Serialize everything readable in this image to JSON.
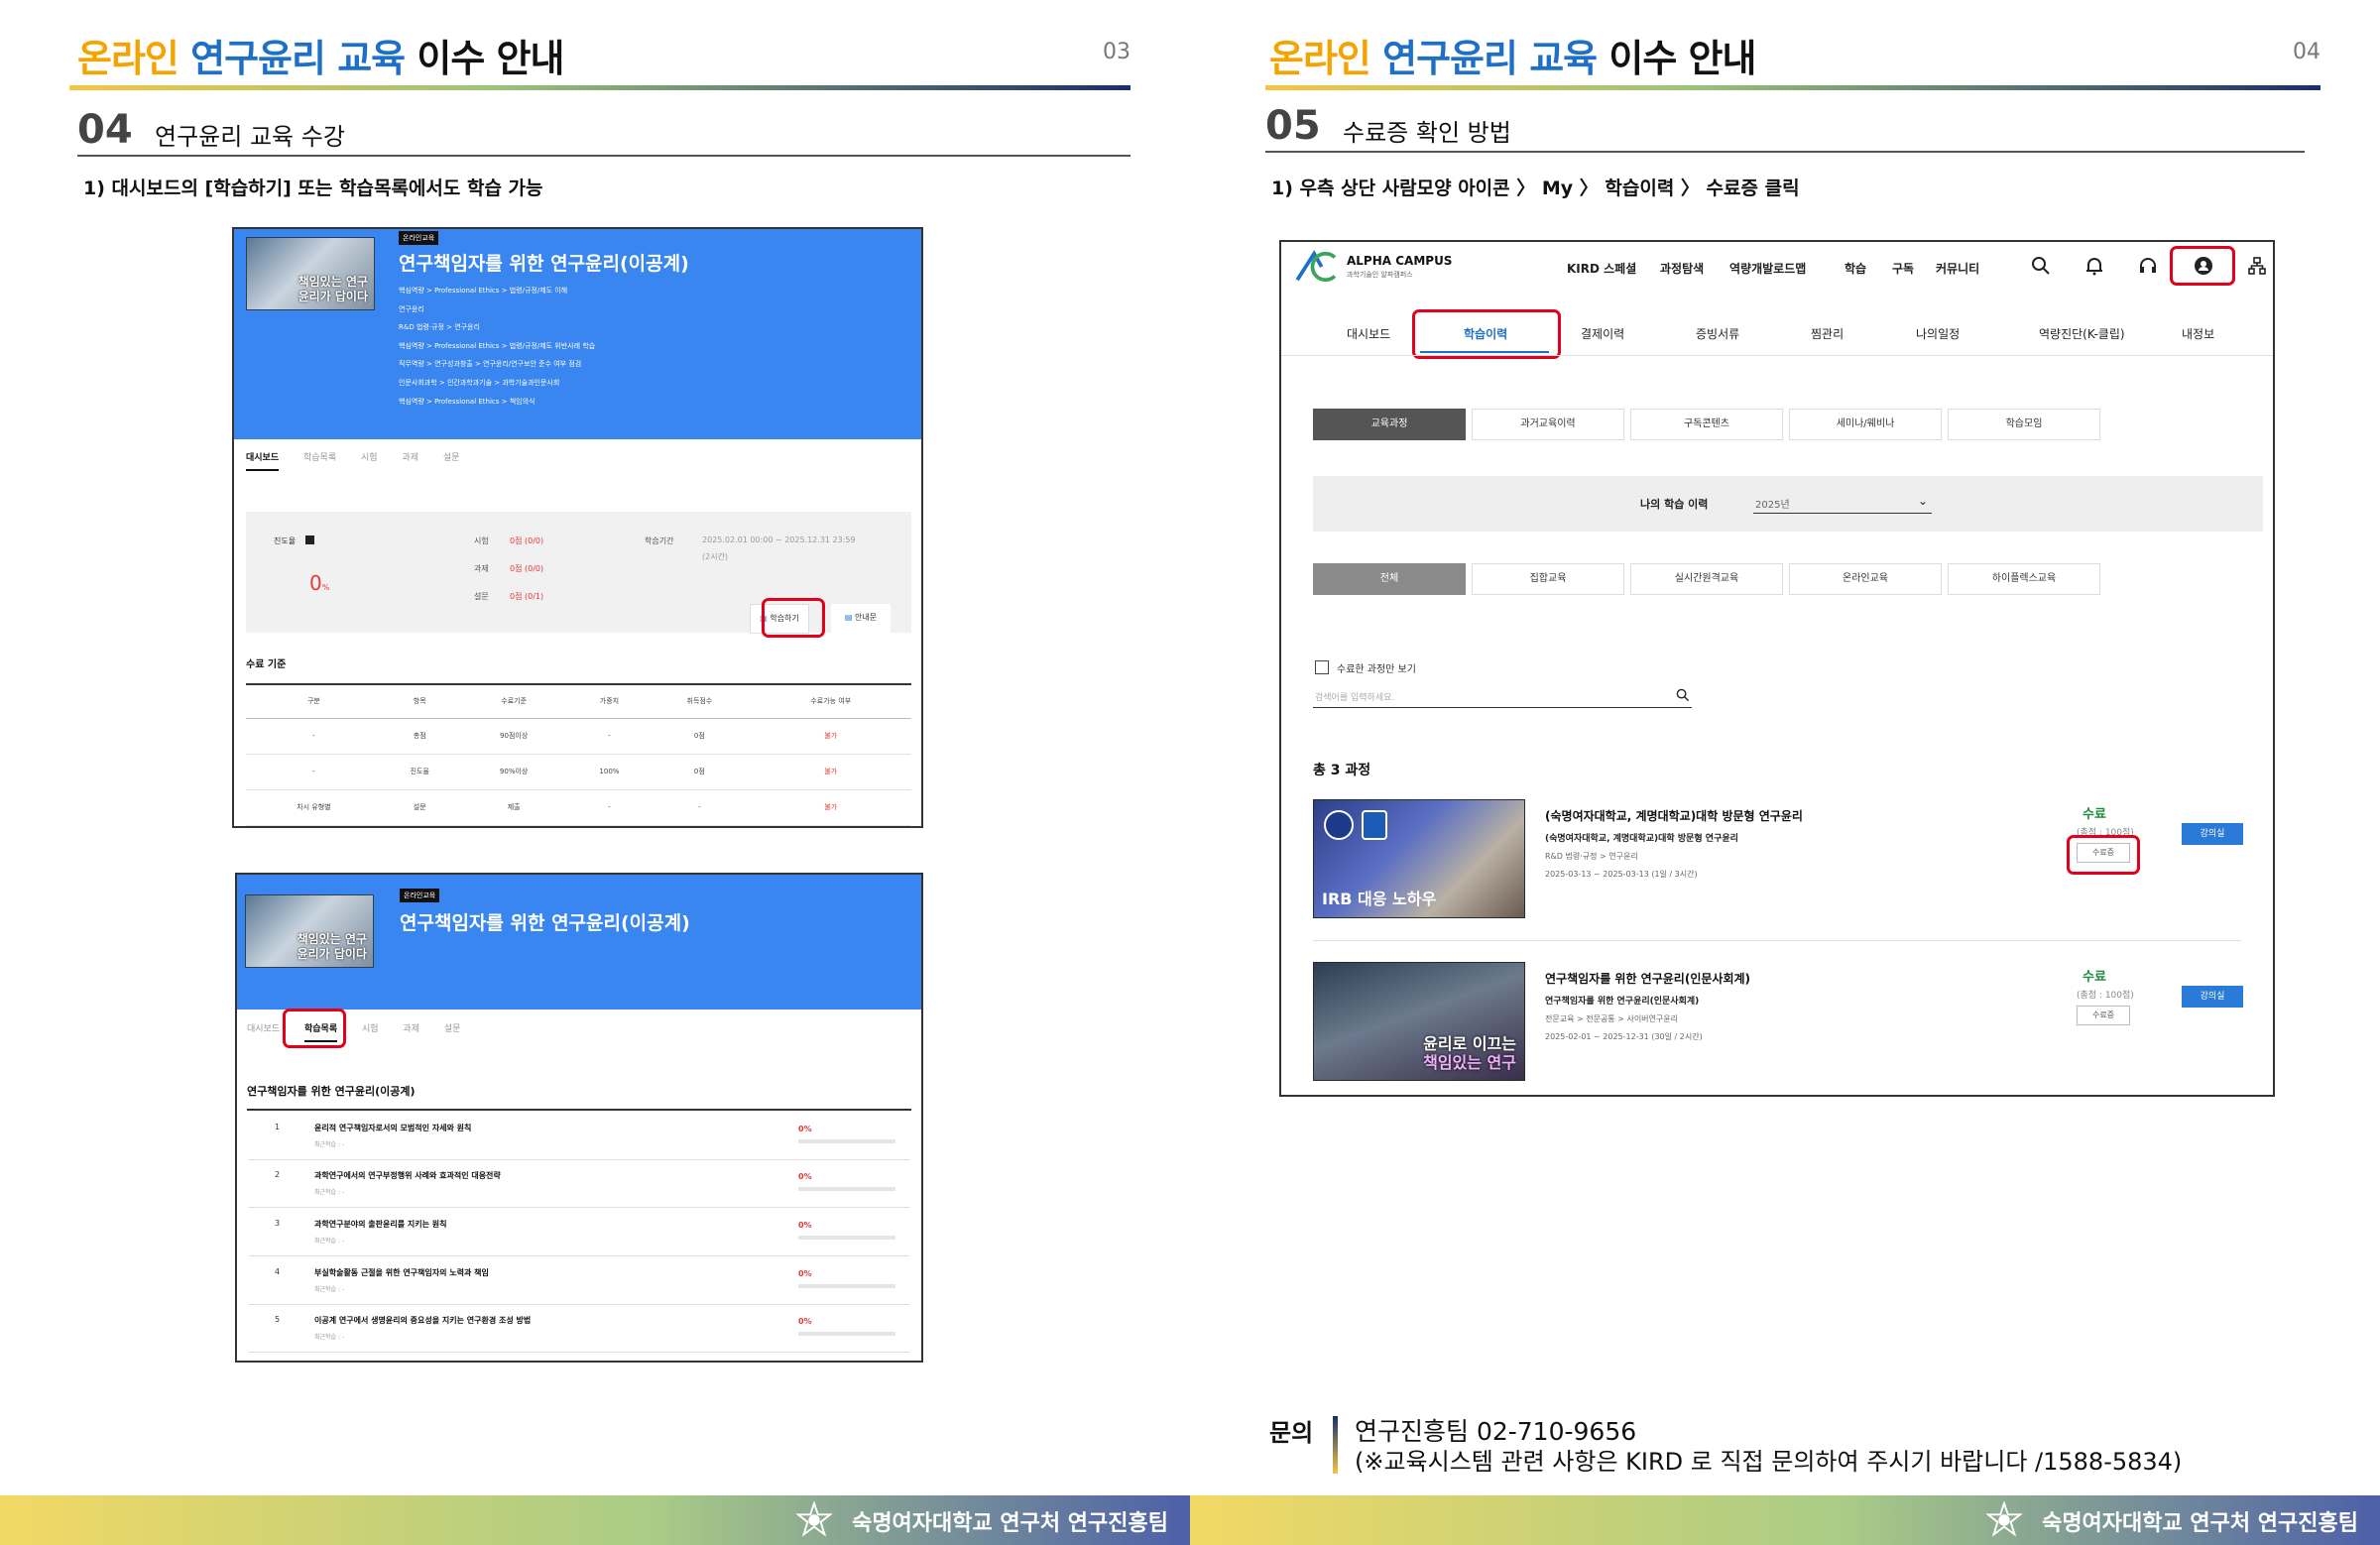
{
  "header": {
    "title_part1": "온라인",
    "title_part2": "연구윤리 교육",
    "title_part3": "이수 안내",
    "page_left": "03",
    "page_right": "04"
  },
  "left": {
    "section_num": "04",
    "section_title": "연구윤리 교육 수강",
    "instruction": "1)  대시보드의 [학습하기] 또는 학습목록에서도 학습 가능",
    "shot1": {
      "tag": "온라인교육",
      "thumb_caption_l1": "책임있는 연구",
      "thumb_caption_l2": "윤리가 답이다",
      "course_title": "연구책임자를 위한 연구윤리(이공계)",
      "categories": [
        "핵심역량 > Professional Ethics > 법령/규정/제도 이해",
        "연구윤리",
        "R&D 법령·규정 > 연구윤리",
        "핵심역량 > Professional Ethics > 법령/규정/제도 위반사례 학습",
        "직무역량 > 연구성과창출 > 연구윤리/연구보안 준수 여부 점검",
        "인문사회과학 > 인간과학과기술 > 과학기술과인문사회",
        "핵심역량 > Professional Ethics > 책임의식"
      ],
      "tabs": [
        "대시보드",
        "학습목록",
        "시험",
        "과제",
        "설문"
      ],
      "progress_label": "진도율",
      "progress_value": "0",
      "progress_unit": "%",
      "exam_label": "시험",
      "exam_value": "0점 (0/0)",
      "task_label": "과제",
      "task_value": "0점 (0/0)",
      "survey_label": "설문",
      "survey_value": "0점 (0/1)",
      "period_label": "학습기간",
      "period_value": "2025.02.01 00:00 ~ 2025.12.31 23:59",
      "period_sub": "(2시간)",
      "btn_study": "학습하기",
      "btn_guide": "안내문",
      "criteria_title": "수료 기준",
      "table_headers": [
        "구분",
        "항목",
        "수료기준",
        "가중치",
        "취득점수",
        "수료가능 여부"
      ],
      "table_rows": [
        [
          "-",
          "총점",
          "90점이상",
          "-",
          "0점",
          "불가"
        ],
        [
          "-",
          "진도율",
          "90%이상",
          "100%",
          "0점",
          "불가"
        ],
        [
          "차시 유형별",
          "설문",
          "제출",
          "-",
          "-",
          "불가"
        ]
      ]
    },
    "shot2": {
      "tag": "온라인교육",
      "course_title": "연구책임자를 위한 연구윤리(이공계)",
      "tabs": [
        "대시보드",
        "학습목록",
        "시험",
        "과제",
        "설문"
      ],
      "list_title": "연구책임자를 위한 연구윤리(이공계)",
      "recent_label": "최근학습 : -",
      "items": [
        {
          "n": "1",
          "t": "윤리적 연구책임자로서의 모범적인 자세와 원칙",
          "p": "0%"
        },
        {
          "n": "2",
          "t": "과학연구에서의 연구부정행위 사례와 효과적인 대응전략",
          "p": "0%"
        },
        {
          "n": "3",
          "t": "과학연구분야의 출판윤리를 지키는 원칙",
          "p": "0%"
        },
        {
          "n": "4",
          "t": "부실학술활동 근절을 위한 연구책임자의 노력과 책임",
          "p": "0%"
        },
        {
          "n": "5",
          "t": "이공계 연구에서 생명윤리의 중요성을 지키는 연구환경 조성 방법",
          "p": "0%"
        }
      ]
    }
  },
  "right": {
    "section_num": "05",
    "section_title": "수료증 확인 방법",
    "instruction": "1)  우측 상단 사람모양 아이콘 〉 My 〉 학습이력 〉 수료증 클릭",
    "shot": {
      "logo_name": "ALPHA CAMPUS",
      "logo_sub": "과학기술인 알파캠퍼스",
      "top_nav": [
        "KIRD 스페셜",
        "과정탐색",
        "역량개발로드맵",
        "학습",
        "구독",
        "커뮤니티"
      ],
      "sub_nav": [
        "대시보드",
        "학습이력",
        "결제이력",
        "증빙서류",
        "찜관리",
        "나의일정",
        "역량진단(K-클립)",
        "내정보"
      ],
      "filter1": [
        "교육과정",
        "과거교육이력",
        "구독콘텐츠",
        "세미나/웨비나",
        "학습모임"
      ],
      "history_label": "나의 학습 이력",
      "year_value": "2025년",
      "filter2": [
        "전체",
        "집합교육",
        "실시간원격교육",
        "온라인교육",
        "하이플렉스교육"
      ],
      "checkbox_label": "수료한 과정만 보기",
      "search_placeholder": "검색어를 입력하세요.",
      "total": "총 3 과정",
      "courses": [
        {
          "img_caption": "IRB 대응 노하우",
          "t1": "(숙명여자대학교, 계명대학교)대학 방문형 연구윤리",
          "t2": "(숙명여자대학교, 계명대학교)대학 방문형 연구윤리",
          "t3": "R&D 법령·규정 > 연구윤리",
          "t4": "2025-03-13 ~ 2025-03-13 (1일 / 3시간)",
          "status": "수료",
          "score": "(총점 : 100점)",
          "cert": "수료증",
          "room": "강의실"
        },
        {
          "img_caption_l1": "윤리로 이끄는",
          "img_caption_l2": "책임있는 연구",
          "t1": "연구책임자를 위한 연구윤리(인문사회계)",
          "t2": "연구책임자를 위한 연구윤리(인문사회계)",
          "t3": "전문교육 > 전문공통 > 사이버연구윤리",
          "t4": "2025-02-01 ~ 2025-12-31 (30일 / 2시간)",
          "status": "수료",
          "score": "(총점 : 100점)",
          "cert": "수료증",
          "room": "강의실"
        }
      ]
    },
    "contact_label": "문의",
    "contact_line1": "연구진흥팀 02-710-9656",
    "contact_line2": "(※교육시스템 관련 사항은 KIRD 로 직접 문의하여 주시기 바랍니다 /1588-5834)"
  },
  "footer": {
    "org": "숙명여자대학교 연구처 연구진흥팀"
  },
  "colors": {
    "accent_orange": "#f5a300",
    "accent_blue": "#1e6fc7",
    "banner_blue": "#3a86f0",
    "highlight_red": "#e3001b",
    "done_green": "#1c8b3c"
  }
}
